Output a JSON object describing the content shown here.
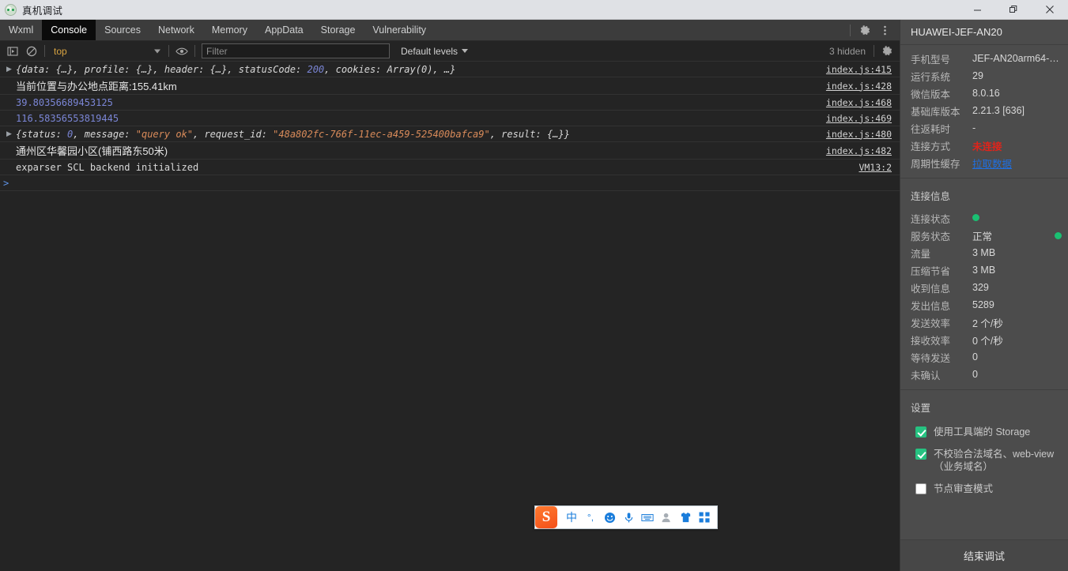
{
  "window": {
    "title": "真机调试",
    "app_icon": "wechat-devtools-icon",
    "minimize_label": "最小化",
    "maximize_label": "最大化",
    "close_label": "关闭"
  },
  "tabs": [
    {
      "label": "Wxml",
      "active": false
    },
    {
      "label": "Console",
      "active": true
    },
    {
      "label": "Sources",
      "active": false
    },
    {
      "label": "Network",
      "active": false
    },
    {
      "label": "Memory",
      "active": false
    },
    {
      "label": "AppData",
      "active": false
    },
    {
      "label": "Storage",
      "active": false
    },
    {
      "label": "Vulnerability",
      "active": false
    }
  ],
  "tabstrip_actions": {
    "settings_label": "Settings",
    "more_label": "More options"
  },
  "console_toolbar": {
    "sidebar_toggle": "Show console sidebar",
    "clear_label": "Clear console",
    "context_value": "top",
    "eye_label": "Create live expression",
    "filter_placeholder": "Filter",
    "filter_value": "",
    "levels_label": "Default levels",
    "hidden_text": "3 hidden",
    "settings_label": "Console settings"
  },
  "console_logs": [
    {
      "expandable": true,
      "kind": "object",
      "tokens": [
        {
          "t": "{data: {…}, profile: {…}, header: {…}, statusCode: ",
          "c": "plain"
        },
        {
          "t": "200",
          "c": "num"
        },
        {
          "t": ", cookies: Array(0), …}",
          "c": "plain"
        }
      ],
      "source": "index.js:415"
    },
    {
      "expandable": false,
      "kind": "zh",
      "tokens": [
        {
          "t": "当前位置与办公地点距离:155.41km",
          "c": "plain"
        }
      ],
      "source": "index.js:428"
    },
    {
      "expandable": false,
      "kind": "number",
      "tokens": [
        {
          "t": "39.80356689453125",
          "c": "plain"
        }
      ],
      "source": "index.js:468"
    },
    {
      "expandable": false,
      "kind": "number",
      "tokens": [
        {
          "t": "116.58356553819445",
          "c": "plain"
        }
      ],
      "source": "index.js:469"
    },
    {
      "expandable": true,
      "kind": "object",
      "tokens": [
        {
          "t": "{status: ",
          "c": "plain"
        },
        {
          "t": "0",
          "c": "num"
        },
        {
          "t": ", message: ",
          "c": "plain"
        },
        {
          "t": "\"query ok\"",
          "c": "str"
        },
        {
          "t": ", request_id: ",
          "c": "plain"
        },
        {
          "t": "\"48a802fc-766f-11ec-a459-525400bafca9\"",
          "c": "str"
        },
        {
          "t": ", result: {…}}",
          "c": "plain"
        }
      ],
      "source": "index.js:480"
    },
    {
      "expandable": false,
      "kind": "zh",
      "tokens": [
        {
          "t": "通州区华馨园小区(铺西路东50米)",
          "c": "plain"
        }
      ],
      "source": "index.js:482"
    },
    {
      "expandable": false,
      "kind": "mono",
      "tokens": [
        {
          "t": "exparser SCL backend initialized",
          "c": "plain"
        }
      ],
      "source": "VM13:2"
    }
  ],
  "console_prompt": {
    "caret": ">",
    "value": ""
  },
  "ime_bar": {
    "logo": "sogou-ime-logo",
    "items": [
      {
        "glyph": "中",
        "name": "language-mode-icon"
      },
      {
        "glyph": "°,",
        "name": "punctuation-mode-icon"
      },
      {
        "glyph": "☺",
        "name": "emoji-icon"
      },
      {
        "glyph": "🎤",
        "name": "voice-input-icon"
      },
      {
        "glyph": "▦",
        "name": "soft-keyboard-icon"
      },
      {
        "glyph": "👤",
        "name": "user-account-icon"
      },
      {
        "glyph": "👕",
        "name": "skin-theme-icon"
      },
      {
        "glyph": "▞",
        "name": "toolbox-icon"
      }
    ]
  },
  "right_panel": {
    "device_title": "HUAWEI-JEF-AN20",
    "device_info": [
      {
        "label": "手机型号",
        "value": "JEF-AN20arm64-…",
        "style": "plain"
      },
      {
        "label": "运行系统",
        "value": "29",
        "style": "plain"
      },
      {
        "label": "微信版本",
        "value": "8.0.16",
        "style": "plain"
      },
      {
        "label": "基础库版本",
        "value": "2.21.3 [636]",
        "style": "plain"
      },
      {
        "label": "往返耗时",
        "value": "-",
        "style": "plain"
      },
      {
        "label": "连接方式",
        "value": "未连接",
        "style": "danger"
      },
      {
        "label": "周期性缓存",
        "value": "拉取数据",
        "style": "link"
      }
    ],
    "connection_section_title": "连接信息",
    "connection_info": [
      {
        "label": "连接状态",
        "value": "",
        "dot": true,
        "dot_right": false
      },
      {
        "label": "服务状态",
        "value": "正常",
        "dot": false,
        "dot_right": true
      },
      {
        "label": "流量",
        "value": "3 MB",
        "dot": false,
        "dot_right": false
      },
      {
        "label": "压缩节省",
        "value": "3 MB",
        "dot": false,
        "dot_right": false
      },
      {
        "label": "收到信息",
        "value": "329",
        "dot": false,
        "dot_right": false
      },
      {
        "label": "发出信息",
        "value": "5289",
        "dot": false,
        "dot_right": false
      },
      {
        "label": "发送效率",
        "value": "2 个/秒",
        "dot": false,
        "dot_right": false
      },
      {
        "label": "接收效率",
        "value": "0 个/秒",
        "dot": false,
        "dot_right": false
      },
      {
        "label": "等待发送",
        "value": "0",
        "dot": false,
        "dot_right": false
      },
      {
        "label": "未确认",
        "value": "0",
        "dot": false,
        "dot_right": false
      }
    ],
    "settings_section_title": "设置",
    "settings": [
      {
        "label": "使用工具端的 Storage",
        "checked": true
      },
      {
        "label": "不校验合法域名、web-view（业务域名）",
        "checked": true
      },
      {
        "label": "节点审查模式",
        "checked": false
      }
    ],
    "footer_button": "结束调试",
    "colors": {
      "accent_green": "#1ac072",
      "danger_red": "#e2231a",
      "link_blue": "#1f6fe0",
      "panel_bg": "#4c4c4c"
    }
  }
}
